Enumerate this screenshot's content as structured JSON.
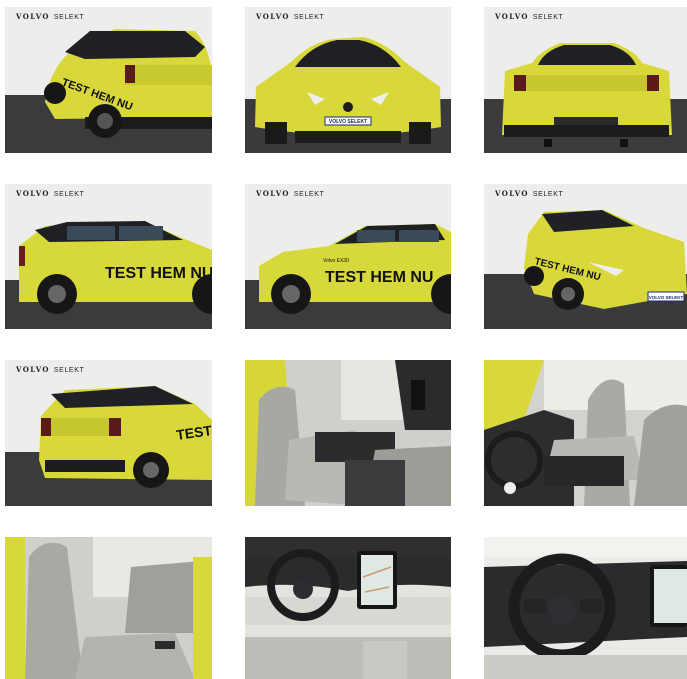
{
  "gallery": {
    "brand_main": "VOLVO",
    "brand_sub": "SELEKT",
    "decal_text": "TEST HEM NU",
    "decal_small": "Volvo EX30",
    "plate_text": "VOLVO SELEKT",
    "tiles": [
      {
        "view": "rear three-quarter left",
        "branded": true
      },
      {
        "view": "front",
        "branded": true
      },
      {
        "view": "rear",
        "branded": true
      },
      {
        "view": "side left",
        "branded": true
      },
      {
        "view": "side right",
        "branded": true
      },
      {
        "view": "front three-quarter right",
        "branded": true
      },
      {
        "view": "rear three-quarter right",
        "branded": true
      },
      {
        "view": "front seats",
        "branded": false
      },
      {
        "view": "driver seat",
        "branded": false
      },
      {
        "view": "rear seats",
        "branded": false
      },
      {
        "view": "dashboard",
        "branded": false
      },
      {
        "view": "steering wheel",
        "branded": false
      }
    ]
  },
  "colors": {
    "body": "#d7d83a",
    "roof": "#1d1f24",
    "ground": "#3a3a3c",
    "backdrop": "#ececea",
    "seat": "#a9aaa4",
    "interior_dark": "#2b2c2e"
  }
}
